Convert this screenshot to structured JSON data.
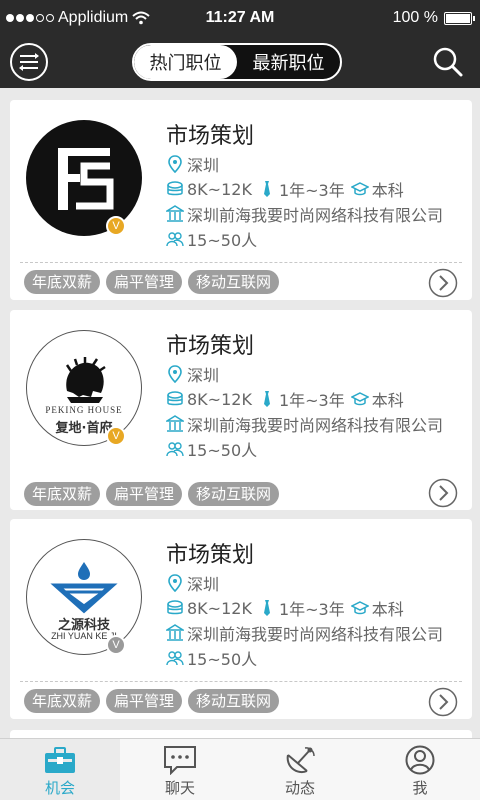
{
  "status_bar": {
    "carrier": "Applidium",
    "time": "11:27 AM",
    "battery": "100 %"
  },
  "nav": {
    "segments": [
      {
        "label": "热门职位",
        "active": true
      },
      {
        "label": "最新职位",
        "active": false
      }
    ]
  },
  "jobs": [
    {
      "title": "市场策划",
      "city": "深圳",
      "salary": "8K~12K",
      "experience": "1年~3年",
      "education": "本科",
      "company": "深圳前海我要时尚网络科技有限公司",
      "size": "15~50人",
      "tags": [
        "年底双薪",
        "扁平管理",
        "移动互联网"
      ],
      "verified": "V"
    },
    {
      "title": "市场策划",
      "city": "深圳",
      "salary": "8K~12K",
      "experience": "1年~3年",
      "education": "本科",
      "company": "深圳前海我要时尚网络科技有限公司",
      "size": "15~50人",
      "tags": [
        "年底双薪",
        "扁平管理",
        "移动互联网"
      ],
      "verified": "V",
      "logo_brand_en": "PEKING HOUSE",
      "logo_brand_cn": "复地·首府"
    },
    {
      "title": "市场策划",
      "city": "深圳",
      "salary": "8K~12K",
      "experience": "1年~3年",
      "education": "本科",
      "company": "深圳前海我要时尚网络科技有限公司",
      "size": "15~50人",
      "tags": [
        "年底双薪",
        "扁平管理",
        "移动互联网"
      ],
      "verified": "V",
      "logo_brand_cn": "之源科技",
      "logo_brand_en": "ZHI YUAN KE JI"
    }
  ],
  "tab_bar": [
    {
      "label": "机会",
      "icon": "briefcase-icon",
      "active": true
    },
    {
      "label": "聊天",
      "icon": "chat-bubble-icon",
      "active": false
    },
    {
      "label": "动态",
      "icon": "radar-icon",
      "active": false
    },
    {
      "label": "我",
      "icon": "user-icon",
      "active": false
    }
  ],
  "colors": {
    "accent": "#2aa9c9",
    "bar_dark": "#2b2b2b",
    "tag_bg": "#9e9e9e",
    "badge_gold": "#e8a824"
  }
}
